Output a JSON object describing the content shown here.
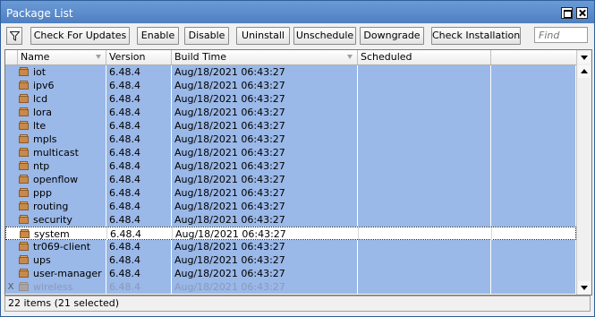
{
  "window": {
    "title": "Package List"
  },
  "toolbar": {
    "buttons": [
      {
        "name": "check-for-updates-button",
        "label": "Check For Updates"
      },
      {
        "name": "enable-button",
        "label": "Enable"
      },
      {
        "name": "disable-button",
        "label": "Disable"
      },
      {
        "name": "uninstall-button",
        "label": "Uninstall"
      },
      {
        "name": "unschedule-button",
        "label": "Unschedule"
      },
      {
        "name": "downgrade-button",
        "label": "Downgrade"
      },
      {
        "name": "check-installation-button",
        "label": "Check Installation"
      }
    ],
    "find_placeholder": "Find",
    "icons": {
      "filter": "filter-icon"
    }
  },
  "table": {
    "columns": [
      "Name",
      "Version",
      "Build Time",
      "Scheduled"
    ],
    "rows": [
      {
        "flag": "",
        "name": "iot",
        "version": "6.48.4",
        "build_time": "Aug/18/2021 06:43:27",
        "scheduled": "",
        "selected": true,
        "disabled": false
      },
      {
        "flag": "",
        "name": "ipv6",
        "version": "6.48.4",
        "build_time": "Aug/18/2021 06:43:27",
        "scheduled": "",
        "selected": true,
        "disabled": false
      },
      {
        "flag": "",
        "name": "lcd",
        "version": "6.48.4",
        "build_time": "Aug/18/2021 06:43:27",
        "scheduled": "",
        "selected": true,
        "disabled": false
      },
      {
        "flag": "",
        "name": "lora",
        "version": "6.48.4",
        "build_time": "Aug/18/2021 06:43:27",
        "scheduled": "",
        "selected": true,
        "disabled": false
      },
      {
        "flag": "",
        "name": "lte",
        "version": "6.48.4",
        "build_time": "Aug/18/2021 06:43:27",
        "scheduled": "",
        "selected": true,
        "disabled": false
      },
      {
        "flag": "",
        "name": "mpls",
        "version": "6.48.4",
        "build_time": "Aug/18/2021 06:43:27",
        "scheduled": "",
        "selected": true,
        "disabled": false
      },
      {
        "flag": "",
        "name": "multicast",
        "version": "6.48.4",
        "build_time": "Aug/18/2021 06:43:27",
        "scheduled": "",
        "selected": true,
        "disabled": false
      },
      {
        "flag": "",
        "name": "ntp",
        "version": "6.48.4",
        "build_time": "Aug/18/2021 06:43:27",
        "scheduled": "",
        "selected": true,
        "disabled": false
      },
      {
        "flag": "",
        "name": "openflow",
        "version": "6.48.4",
        "build_time": "Aug/18/2021 06:43:27",
        "scheduled": "",
        "selected": true,
        "disabled": false
      },
      {
        "flag": "",
        "name": "ppp",
        "version": "6.48.4",
        "build_time": "Aug/18/2021 06:43:27",
        "scheduled": "",
        "selected": true,
        "disabled": false
      },
      {
        "flag": "",
        "name": "routing",
        "version": "6.48.4",
        "build_time": "Aug/18/2021 06:43:27",
        "scheduled": "",
        "selected": true,
        "disabled": false
      },
      {
        "flag": "",
        "name": "security",
        "version": "6.48.4",
        "build_time": "Aug/18/2021 06:43:27",
        "scheduled": "",
        "selected": true,
        "disabled": false
      },
      {
        "flag": "",
        "name": "system",
        "version": "6.48.4",
        "build_time": "Aug/18/2021 06:43:27",
        "scheduled": "",
        "selected": false,
        "disabled": false
      },
      {
        "flag": "",
        "name": "tr069-client",
        "version": "6.48.4",
        "build_time": "Aug/18/2021 06:43:27",
        "scheduled": "",
        "selected": true,
        "disabled": false
      },
      {
        "flag": "",
        "name": "ups",
        "version": "6.48.4",
        "build_time": "Aug/18/2021 06:43:27",
        "scheduled": "",
        "selected": true,
        "disabled": false
      },
      {
        "flag": "",
        "name": "user-manager",
        "version": "6.48.4",
        "build_time": "Aug/18/2021 06:43:27",
        "scheduled": "",
        "selected": true,
        "disabled": false
      },
      {
        "flag": "X",
        "name": "wireless",
        "version": "6.48.4",
        "build_time": "Aug/18/2021 06:43:27",
        "scheduled": "",
        "selected": true,
        "disabled": true
      }
    ]
  },
  "status": {
    "text": "22 items (21 selected)"
  },
  "colors": {
    "titlebar": "#5a8acb",
    "selection": "#9ab8e8"
  }
}
